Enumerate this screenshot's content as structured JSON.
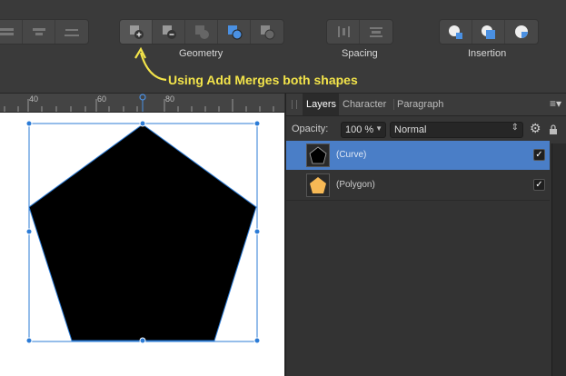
{
  "toolbar": {
    "groups": {
      "geometry": "Geometry",
      "spacing": "Spacing",
      "insertion": "Insertion"
    },
    "annotation": "Using Add Merges both shapes"
  },
  "ruler": {
    "labels": [
      "40",
      "60",
      "80"
    ]
  },
  "panel": {
    "tabs": [
      "Layers",
      "Character",
      "Paragraph"
    ],
    "opacity_label": "Opacity:",
    "opacity_value": "100 %",
    "blend_mode": "Normal",
    "layers": [
      {
        "name": "(Curve)",
        "selected": true,
        "checked": "✓"
      },
      {
        "name": "(Polygon)",
        "selected": false,
        "checked": "✓"
      }
    ]
  },
  "colors": {
    "accent": "#4a7ec7",
    "annotation": "#f3e44a",
    "polygon_fill": "#f7b955",
    "selection": "#2b7bd6"
  }
}
